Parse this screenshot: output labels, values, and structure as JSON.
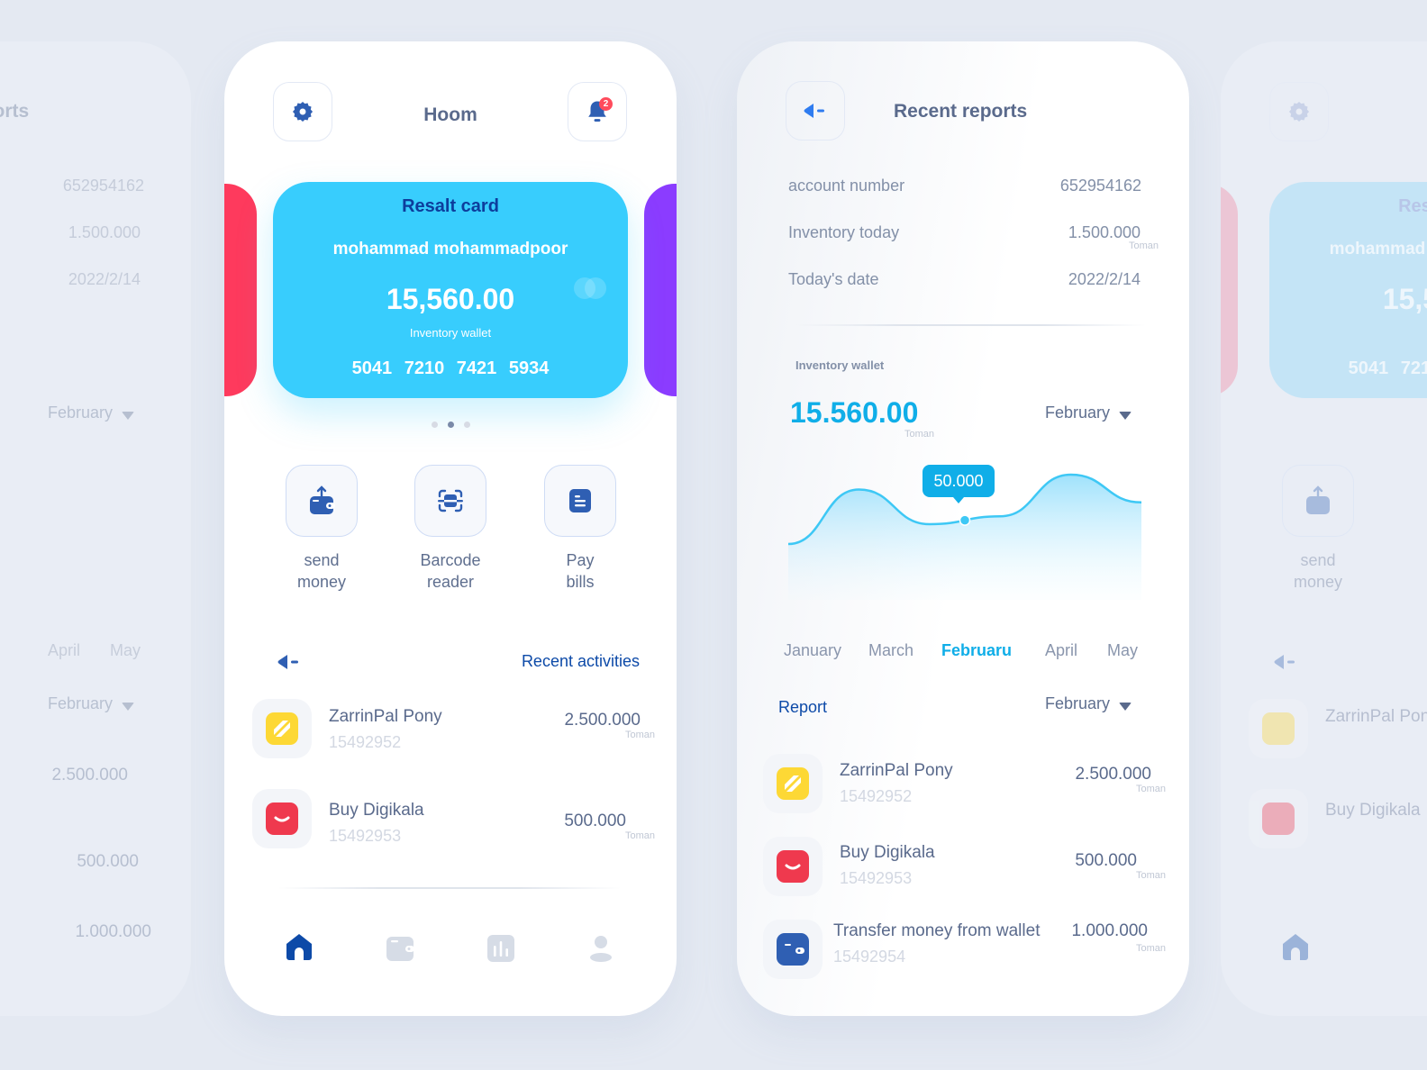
{
  "home": {
    "title": "Hoom",
    "notification_count": "2",
    "card": {
      "title": "Resalt card",
      "holder": "mohammad mohammadpoor",
      "balance": "15,560.00",
      "balance_label": "Inventory wallet",
      "number": "5041  7210  7421  5934"
    },
    "carousel": {
      "count": 3,
      "active_index": 1
    },
    "actions": [
      {
        "icon": "send-money-icon",
        "line1": "send",
        "line2": "money"
      },
      {
        "icon": "barcode-icon",
        "line1": "Barcode",
        "line2": "reader"
      },
      {
        "icon": "bill-icon",
        "line1": "Pay",
        "line2": "bills"
      }
    ],
    "recent_title": "Recent activities",
    "activities": [
      {
        "name": "ZarrinPal Pony",
        "id": "15492952",
        "amount": "2.500.000",
        "currency": "Toman",
        "icon": "zarrinpal-icon",
        "color": "#fdd835"
      },
      {
        "name": "Buy Digikala",
        "id": "15492953",
        "amount": "500.000",
        "currency": "Toman",
        "icon": "digikala-icon",
        "color": "#ef394e"
      }
    ],
    "nav": [
      {
        "icon": "home-icon",
        "active": true
      },
      {
        "icon": "wallet-icon",
        "active": false
      },
      {
        "icon": "chart-icon",
        "active": false
      },
      {
        "icon": "profile-icon",
        "active": false
      }
    ]
  },
  "reports": {
    "title": "Recent reports",
    "details": [
      {
        "label": "account number",
        "value": "652954162"
      },
      {
        "label": "Inventory today",
        "value": "1.500.000",
        "currency": "Toman"
      },
      {
        "label": "Today's date",
        "value": "2022/2/14"
      }
    ],
    "wallet_label": "Inventory wallet",
    "wallet_balance": "15.560.00",
    "wallet_currency": "Toman",
    "period_select": "February",
    "tooltip_value": "50.000",
    "months": [
      "January",
      "March",
      "Februaru",
      "April",
      "May"
    ],
    "active_month": "Februaru",
    "report_label": "Report",
    "report_period_select": "February",
    "transactions": [
      {
        "name": "ZarrinPal Pony",
        "id": "15492952",
        "amount": "2.500.000",
        "currency": "Toman",
        "icon": "zarrinpal-icon"
      },
      {
        "name": "Buy Digikala",
        "id": "15492953",
        "amount": "500.000",
        "currency": "Toman",
        "icon": "digikala-icon"
      },
      {
        "name": "Transfer money from wallet",
        "id": "15492954",
        "amount": "1.000.000",
        "currency": "Toman",
        "icon": "wallet-icon"
      }
    ]
  },
  "colors": {
    "accent_blue": "#0d4aa8",
    "card_cyan": "#38cdfd",
    "chart_line": "#3ec8f5",
    "active_month": "#10aee8",
    "red_card": "#fe3a5d",
    "purple_card": "#8b3cff",
    "badge_red": "#ff4b5c"
  },
  "chart_data": {
    "type": "area",
    "title": "Inventory wallet",
    "categories": [
      "January",
      "March",
      "Februaru",
      "April",
      "May"
    ],
    "series": [
      {
        "name": "Inventory wallet",
        "values": [
          20,
          75,
          40,
          48,
          90,
          62
        ]
      }
    ],
    "highlight": {
      "label": "50.000",
      "category": "Februaru"
    },
    "grid": false,
    "legend": "none"
  }
}
